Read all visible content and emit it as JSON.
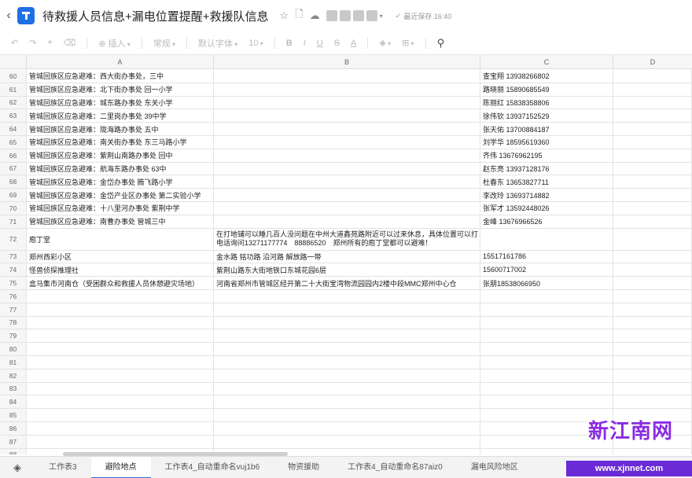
{
  "title": "待救援人员信息+漏电位置提醒+救援队信息",
  "save_status": "最近保存 16:40",
  "toolbar": {
    "insert": "插入",
    "format": "常规",
    "font": "默认字体",
    "size": "10"
  },
  "columns": [
    "A",
    "B",
    "C",
    "D"
  ],
  "rows": [
    {
      "n": "60",
      "a": "管城回族区应急避难：西大街办事处，三中",
      "b": "",
      "c": "查宝翔 13938266802"
    },
    {
      "n": "61",
      "a": "管城回族区应急避难：北下街办事处 回一小学",
      "b": "",
      "c": "路晓丽 15890685549"
    },
    {
      "n": "62",
      "a": "管城回族区应急避难：城东路办事处 东关小学",
      "b": "",
      "c": "陈丽红 15838358806"
    },
    {
      "n": "63",
      "a": "管城回族区应急避难：二里岗办事处 39中学",
      "b": "",
      "c": "徐伟钦 13937152529"
    },
    {
      "n": "64",
      "a": "管城回族区应急避难：陇海路办事处 五中",
      "b": "",
      "c": "张天佑 13700884187"
    },
    {
      "n": "65",
      "a": "管城回族区应急避难：南关街办事处 东三马路小学",
      "b": "",
      "c": "刘学华 18595619360"
    },
    {
      "n": "66",
      "a": "管城回族区应急避难：紫荆山南路办事处 回中",
      "b": "",
      "c": "齐伟 13676962195"
    },
    {
      "n": "67",
      "a": "管城回族区应急避难：航海东路办事处 63中",
      "b": "",
      "c": "赵东亮 13937128176"
    },
    {
      "n": "68",
      "a": "管城回族区应急避难：金岱办事处 腾飞路小学",
      "b": "",
      "c": "杜春东 13653827711"
    },
    {
      "n": "69",
      "a": "管城回族区应急避难：金岱产业区办事处 第二实验小学",
      "b": "",
      "c": "李改玲 13693714882"
    },
    {
      "n": "70",
      "a": "管城回族区应急避难：十八里河办事处 紫荆中学",
      "b": "",
      "c": "张军才 13592448026"
    },
    {
      "n": "71",
      "a": "管城回族区应急避难：南曹办事处 管城三中",
      "b": "",
      "c": "金峰 13676966526"
    },
    {
      "n": "72",
      "a": "庖丁堂",
      "b": "在打地铺可以睡几百人没问题在中州大道鑫苑路附近可以过来休息，具体位置可以打电话询问13271177774　88886520　郑州所有的庖丁堂都可以避难！",
      "c": "",
      "tall": true
    },
    {
      "n": "73",
      "a": "郑州西彩小区",
      "b": "金水路 铭功路 沿河路 解放路一带",
      "c": "15517161786"
    },
    {
      "n": "74",
      "a": "怪兽侦探推理社",
      "b": "紫荆山路东大街地铁口东城花园6层",
      "c": "15600717002"
    },
    {
      "n": "75",
      "a": "盒马集市河南仓（受困群众和救援人员休憩避灾场地）",
      "b": "河南省郑州市管城区经开第二十大街宝湾物流园园内2楼中段MMC郑州中心仓",
      "c": "张朋18538066950"
    },
    {
      "n": "76",
      "a": "",
      "b": "",
      "c": ""
    },
    {
      "n": "77",
      "a": "",
      "b": "",
      "c": ""
    },
    {
      "n": "78",
      "a": "",
      "b": "",
      "c": ""
    },
    {
      "n": "79",
      "a": "",
      "b": "",
      "c": ""
    },
    {
      "n": "80",
      "a": "",
      "b": "",
      "c": ""
    },
    {
      "n": "81",
      "a": "",
      "b": "",
      "c": ""
    },
    {
      "n": "82",
      "a": "",
      "b": "",
      "c": ""
    },
    {
      "n": "83",
      "a": "",
      "b": "",
      "c": ""
    },
    {
      "n": "84",
      "a": "",
      "b": "",
      "c": ""
    },
    {
      "n": "85",
      "a": "",
      "b": "",
      "c": ""
    },
    {
      "n": "86",
      "a": "",
      "b": "",
      "c": ""
    },
    {
      "n": "87",
      "a": "",
      "b": "",
      "c": ""
    },
    {
      "n": "88",
      "a": "",
      "b": "",
      "c": ""
    }
  ],
  "sheet_tabs": [
    {
      "label": "工作表3",
      "active": false
    },
    {
      "label": "避险地点",
      "active": true
    },
    {
      "label": "工作表4_自动重命名vuj1b6",
      "active": false
    },
    {
      "label": "物资援助",
      "active": false
    },
    {
      "label": "工作表4_自动重命名87aiz0",
      "active": false
    },
    {
      "label": "漏电风险地区",
      "active": false
    }
  ],
  "watermark": {
    "text": "新江南网",
    "url": "www.xjnnet.com"
  },
  "colors": {
    "accent": "#1f6fe5",
    "watermark": "#8a2be2"
  }
}
